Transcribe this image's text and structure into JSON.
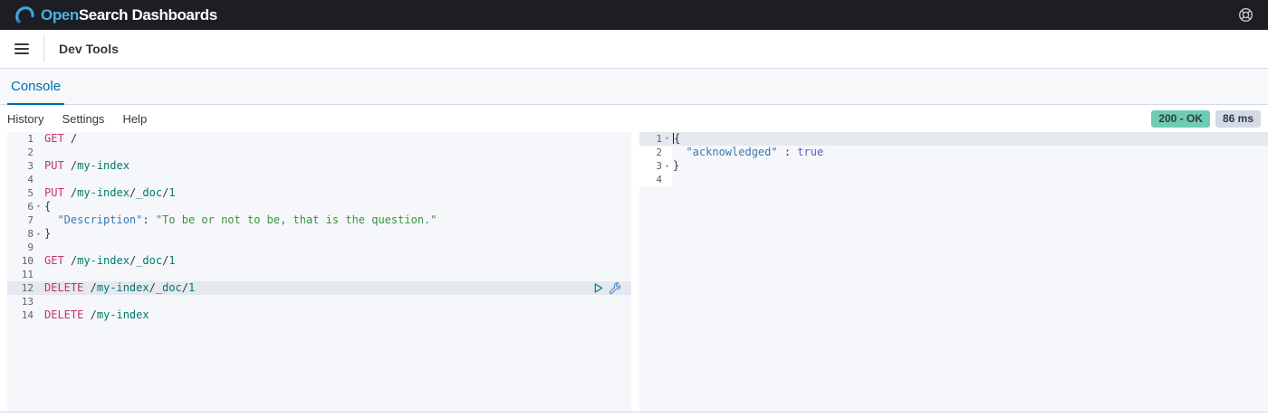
{
  "header": {
    "logo_open": "Open",
    "logo_search": "Search",
    "logo_dashboards": " Dashboards",
    "help_icon": "help-icon",
    "bg_color": "#1D1E24",
    "logo_accent_color": "#4DB1E2"
  },
  "nav": {
    "menu_icon": "menu-icon",
    "breadcrumb": "Dev Tools"
  },
  "tabs": [
    {
      "label": "Console",
      "active": true,
      "accent_color": "#006BB4"
    }
  ],
  "toolbar": {
    "links": [
      "History",
      "Settings",
      "Help"
    ],
    "status_badge": "200 - OK",
    "status_color": "#6DCCB1",
    "time_badge": "86 ms",
    "time_color": "#D3DAE6"
  },
  "request_editor": {
    "actions": {
      "send_icon": "play-icon",
      "options_icon": "wrench-icon"
    },
    "lines": [
      {
        "n": 1,
        "seg": [
          [
            "m",
            "GET"
          ],
          [
            "p",
            " /"
          ]
        ]
      },
      {
        "n": 2,
        "seg": []
      },
      {
        "n": 3,
        "seg": [
          [
            "m",
            "PUT"
          ],
          [
            "p",
            " /"
          ],
          [
            "u",
            "my-index"
          ]
        ]
      },
      {
        "n": 4,
        "seg": []
      },
      {
        "n": 5,
        "seg": [
          [
            "m",
            "PUT"
          ],
          [
            "p",
            " /"
          ],
          [
            "u",
            "my-index"
          ],
          [
            "p",
            "/"
          ],
          [
            "u",
            "_doc"
          ],
          [
            "p",
            "/"
          ],
          [
            "u",
            "1"
          ]
        ]
      },
      {
        "n": 6,
        "fold": "open",
        "seg": [
          [
            "p",
            "{"
          ]
        ]
      },
      {
        "n": 7,
        "seg": [
          [
            "p",
            "  "
          ],
          [
            "k",
            "\"Description\""
          ],
          [
            "p",
            ": "
          ],
          [
            "s",
            "\"To be or not to be, that is the question.\""
          ]
        ]
      },
      {
        "n": 8,
        "fold": "close",
        "seg": [
          [
            "p",
            "}"
          ]
        ]
      },
      {
        "n": 9,
        "seg": []
      },
      {
        "n": 10,
        "seg": [
          [
            "m",
            "GET"
          ],
          [
            "p",
            " /"
          ],
          [
            "u",
            "my-index"
          ],
          [
            "p",
            "/"
          ],
          [
            "u",
            "_doc"
          ],
          [
            "p",
            "/"
          ],
          [
            "u",
            "1"
          ]
        ]
      },
      {
        "n": 11,
        "seg": []
      },
      {
        "n": 12,
        "active": true,
        "actions": true,
        "seg": [
          [
            "m",
            "DELETE"
          ],
          [
            "p",
            " /"
          ],
          [
            "u",
            "my-index"
          ],
          [
            "p",
            "/"
          ],
          [
            "u",
            "_doc"
          ],
          [
            "p",
            "/"
          ],
          [
            "u",
            "1"
          ]
        ]
      },
      {
        "n": 13,
        "seg": []
      },
      {
        "n": 14,
        "seg": [
          [
            "m",
            "DELETE"
          ],
          [
            "p",
            " /"
          ],
          [
            "u",
            "my-index"
          ]
        ]
      }
    ]
  },
  "response_editor": {
    "lines": [
      {
        "n": 1,
        "fold": "open",
        "active": true,
        "cursor": true,
        "seg": [
          [
            "p",
            "{"
          ]
        ]
      },
      {
        "n": 2,
        "seg": [
          [
            "p",
            "  "
          ],
          [
            "k",
            "\"acknowledged\""
          ],
          [
            "p",
            " : "
          ],
          [
            "b",
            "true"
          ]
        ]
      },
      {
        "n": 3,
        "fold": "close",
        "seg": [
          [
            "p",
            "}"
          ]
        ]
      },
      {
        "n": 4,
        "seg": []
      }
    ]
  }
}
